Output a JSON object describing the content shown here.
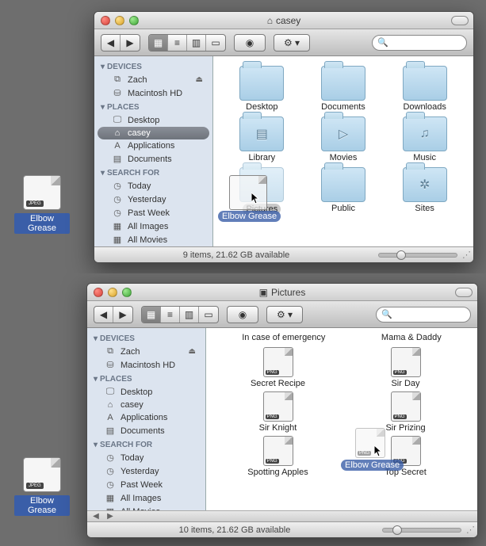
{
  "desktop_file": {
    "label": "Elbow Grease",
    "type": "JPEG"
  },
  "top_window": {
    "title": "casey",
    "title_glyph": "⌂",
    "search_placeholder": "",
    "sidebar": {
      "devices_header": "DEVICES",
      "places_header": "PLACES",
      "search_header": "SEARCH FOR",
      "devices": [
        {
          "label": "Zach",
          "glyph": "⧉",
          "eject": "⏏"
        },
        {
          "label": "Macintosh HD",
          "glyph": "⛁"
        }
      ],
      "places": [
        {
          "label": "Desktop",
          "glyph": "🖵"
        },
        {
          "label": "casey",
          "glyph": "⌂",
          "selected": true
        },
        {
          "label": "Applications",
          "glyph": "A"
        },
        {
          "label": "Documents",
          "glyph": "▤"
        }
      ],
      "search": [
        {
          "label": "Today",
          "glyph": "◷"
        },
        {
          "label": "Yesterday",
          "glyph": "◷"
        },
        {
          "label": "Past Week",
          "glyph": "◷"
        },
        {
          "label": "All Images",
          "glyph": "▦"
        },
        {
          "label": "All Movies",
          "glyph": "▦"
        }
      ]
    },
    "folders": [
      {
        "label": "Desktop",
        "emblem": ""
      },
      {
        "label": "Documents",
        "emblem": ""
      },
      {
        "label": "Downloads",
        "emblem": ""
      },
      {
        "label": "Library",
        "emblem": "▤"
      },
      {
        "label": "Movies",
        "emblem": "▷"
      },
      {
        "label": "Music",
        "emblem": "♫"
      },
      {
        "label": "Pictures",
        "emblem": "",
        "highlight": true,
        "fade": true
      },
      {
        "label": "Public",
        "emblem": ""
      },
      {
        "label": "Sites",
        "emblem": "✲"
      }
    ],
    "status": "9 items, 21.62 GB available",
    "drag_label": "Elbow Grease"
  },
  "bottom_window": {
    "title": "Pictures",
    "title_glyph": "▣",
    "search_placeholder": "",
    "sidebar": {
      "devices_header": "DEVICES",
      "places_header": "PLACES",
      "search_header": "SEARCH FOR",
      "devices": [
        {
          "label": "Zach",
          "glyph": "⧉",
          "eject": "⏏"
        },
        {
          "label": "Macintosh HD",
          "glyph": "⛁"
        }
      ],
      "places": [
        {
          "label": "Desktop",
          "glyph": "🖵"
        },
        {
          "label": "casey",
          "glyph": "⌂"
        },
        {
          "label": "Applications",
          "glyph": "A"
        },
        {
          "label": "Documents",
          "glyph": "▤"
        }
      ],
      "search": [
        {
          "label": "Today",
          "glyph": "◷"
        },
        {
          "label": "Yesterday",
          "glyph": "◷"
        },
        {
          "label": "Past Week",
          "glyph": "◷"
        },
        {
          "label": "All Images",
          "glyph": "▦"
        },
        {
          "label": "All Movies",
          "glyph": "▦"
        }
      ]
    },
    "textrow": {
      "a": "In case of emergency",
      "b": "Mama & Daddy"
    },
    "files": [
      {
        "label": "Secret Recipe"
      },
      {
        "label": "Sir Day"
      },
      {
        "label": "Sir Knight"
      },
      {
        "label": "Sir Prizing"
      },
      {
        "label": "Spotting Apples"
      },
      {
        "label": "Top Secret"
      }
    ],
    "status": "10 items, 21.62 GB available",
    "drag_label": "Elbow Grease"
  }
}
